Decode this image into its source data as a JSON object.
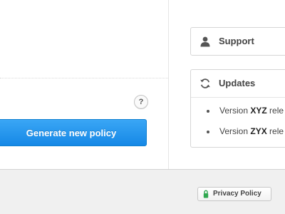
{
  "main": {
    "help_label": "?",
    "generate_button_label": "Generate new policy"
  },
  "sidebar": {
    "support": {
      "title": "Support",
      "icon": "person-icon"
    },
    "updates": {
      "title": "Updates",
      "icon": "refresh-icon",
      "items": [
        {
          "prefix": "Version ",
          "version": "XYZ",
          "suffix": " rele"
        },
        {
          "prefix": "Version ",
          "version": "ZYX",
          "suffix": " rele"
        }
      ]
    }
  },
  "footer": {
    "privacy_label": "Privacy Policy",
    "privacy_icon": "lock-icon"
  },
  "colors": {
    "primary_button": "#1f8ee9",
    "privacy_icon": "#2fa84f"
  }
}
